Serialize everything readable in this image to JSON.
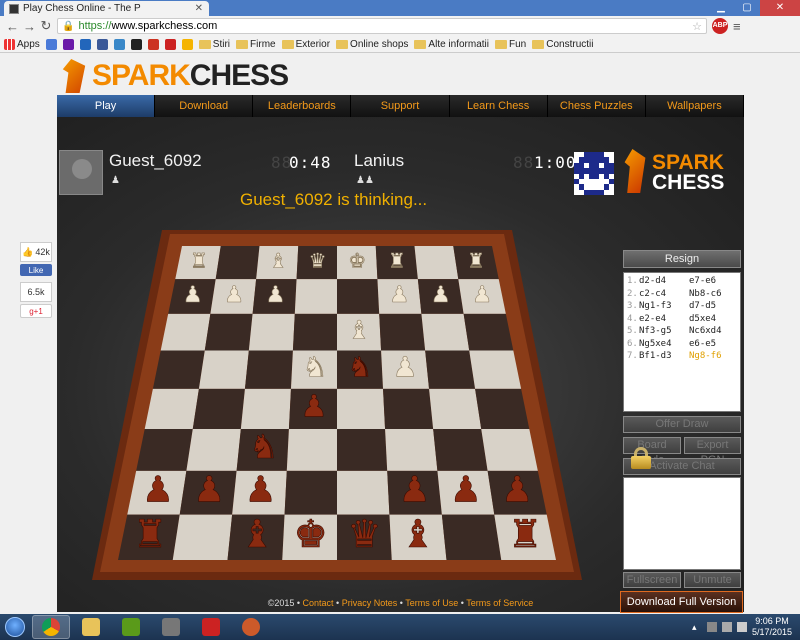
{
  "browser": {
    "tab_title": "Play Chess Online - The P",
    "url_protocol": "https://",
    "url_host": "www.sparkchess.com",
    "abp_label": "ABP"
  },
  "bookmarks": [
    {
      "label": "Apps",
      "type": "apps"
    },
    {
      "label": "",
      "type": "icon",
      "color": "#4a7ad8"
    },
    {
      "label": "",
      "type": "icon",
      "color": "#6a1aa8"
    },
    {
      "label": "",
      "type": "icon",
      "color": "#2266bb"
    },
    {
      "label": "",
      "type": "icon",
      "color": "#3b5998"
    },
    {
      "label": "",
      "type": "icon",
      "color": "#3a88c8"
    },
    {
      "label": "",
      "type": "icon",
      "color": "#222222"
    },
    {
      "label": "",
      "type": "icon",
      "color": "#cc3322"
    },
    {
      "label": "",
      "type": "icon",
      "color": "#cc2222"
    },
    {
      "label": "",
      "type": "icon",
      "color": "#f5b400"
    },
    {
      "label": "Stiri",
      "type": "folder"
    },
    {
      "label": "Firme",
      "type": "folder"
    },
    {
      "label": "Exterior",
      "type": "folder"
    },
    {
      "label": "Online shops",
      "type": "folder"
    },
    {
      "label": "Alte informatii",
      "type": "folder"
    },
    {
      "label": "Fun",
      "type": "folder"
    },
    {
      "label": "Constructii",
      "type": "folder"
    }
  ],
  "site": {
    "logo_spark": "SPARK",
    "logo_chess": "CHESS",
    "nav": [
      "Play",
      "Download",
      "Leaderboards",
      "Support",
      "Learn Chess",
      "Chess Puzzles",
      "Wallpapers"
    ]
  },
  "game": {
    "player_name": "Guest_6092",
    "player_clock": "0:48",
    "player_clock_ghost": "88:",
    "player_captured": "♟",
    "opponent_name": "Lanius",
    "opponent_clock": "1:00",
    "opponent_clock_ghost": "88",
    "opponent_captured": "♟♟",
    "status": "Guest_6092 is thinking...",
    "sidebar_logo_1": "SPARK",
    "sidebar_logo_2": "CHESS",
    "resign": "Resign",
    "offer_draw": "Offer Draw",
    "board_style": "Board Style",
    "export_pgn": "Export PGN",
    "activate_chat": "Activate Chat",
    "fullscreen": "Fullscreen",
    "unmute": "Unmute",
    "download_full": "Download Full Version",
    "moves": [
      {
        "n": "1.",
        "w": "d2-d4",
        "b": "e7-e6"
      },
      {
        "n": "2.",
        "w": "c2-c4",
        "b": "Nb8-c6"
      },
      {
        "n": "3.",
        "w": "Ng1-f3",
        "b": "d7-d5"
      },
      {
        "n": "4.",
        "w": "e2-e4",
        "b": "d5xe4"
      },
      {
        "n": "5.",
        "w": "Nf3-g5",
        "b": "Nc6xd4"
      },
      {
        "n": "6.",
        "w": "Ng5xe4",
        "b": "e6-e5"
      },
      {
        "n": "7.",
        "w": "Bf1-d3",
        "b": "Ng8-f6"
      }
    ]
  },
  "footer": {
    "copy": "©2015 •",
    "links": [
      "Contact",
      "Privacy Notes",
      "Terms of Use",
      "Terms of Service"
    ]
  },
  "social": {
    "likes": "42k",
    "like_label": "Like",
    "shares": "6.5k",
    "gplus": "g+1"
  },
  "taskbar": {
    "time": "9:06 PM",
    "date": "5/17/2015"
  }
}
